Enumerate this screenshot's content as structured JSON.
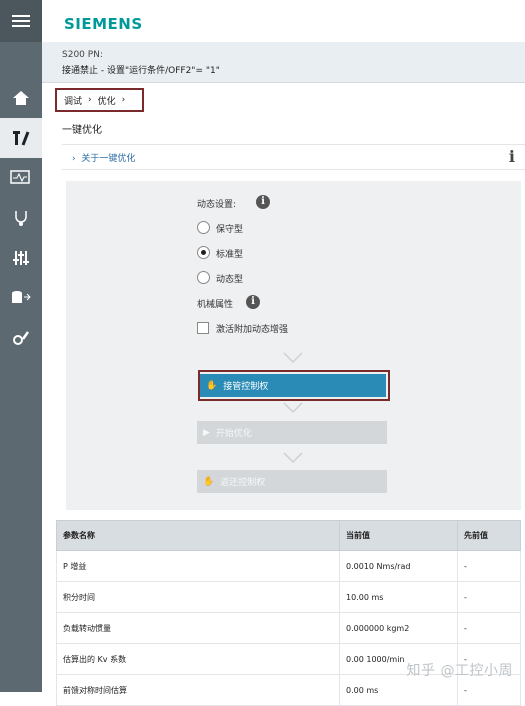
{
  "brand": "SIEMENS",
  "device": {
    "name": "S200 PN:",
    "status": "接通禁止 - 设置\"运行条件/OFF2\"= \"1\""
  },
  "breadcrumb": [
    "调试",
    "优化"
  ],
  "page_title": "一键优化",
  "about_link": "关于一键优化",
  "dynamic": {
    "label": "动态设置:",
    "options": [
      "保守型",
      "标准型",
      "动态型"
    ],
    "selected": "标准型"
  },
  "mechanical": {
    "label": "机械属性",
    "checkbox": "激活附加动态增强"
  },
  "buttons": {
    "take_control": "接管控制权",
    "start": "开始优化",
    "return": "返还控制权"
  },
  "table": {
    "headers": [
      "参数名称",
      "当前值",
      "先前值"
    ],
    "rows": [
      [
        "P 增益",
        "0.0010 Nms/rad",
        "-"
      ],
      [
        "积分时间",
        "10.00 ms",
        "-"
      ],
      [
        "负载转动惯量",
        "0.000000 kgm2",
        "-"
      ],
      [
        "估算出的 Kv 系数",
        "0.00 1000/min",
        "-"
      ],
      [
        "前馈对称时间估算",
        "0.00 ms",
        "-"
      ]
    ]
  },
  "watermark": "知乎 @工控小周",
  "colors": {
    "brand": "#009999",
    "sidebar": "#5d6970",
    "primary_button": "#2a8bb6",
    "highlight_frame": "#7a2a2a"
  },
  "sidebar_icons": [
    "menu-icon",
    "home-icon",
    "tools-icon",
    "monitor-icon",
    "diagnostics-icon",
    "parameters-icon",
    "data-icon",
    "settings-icon"
  ]
}
